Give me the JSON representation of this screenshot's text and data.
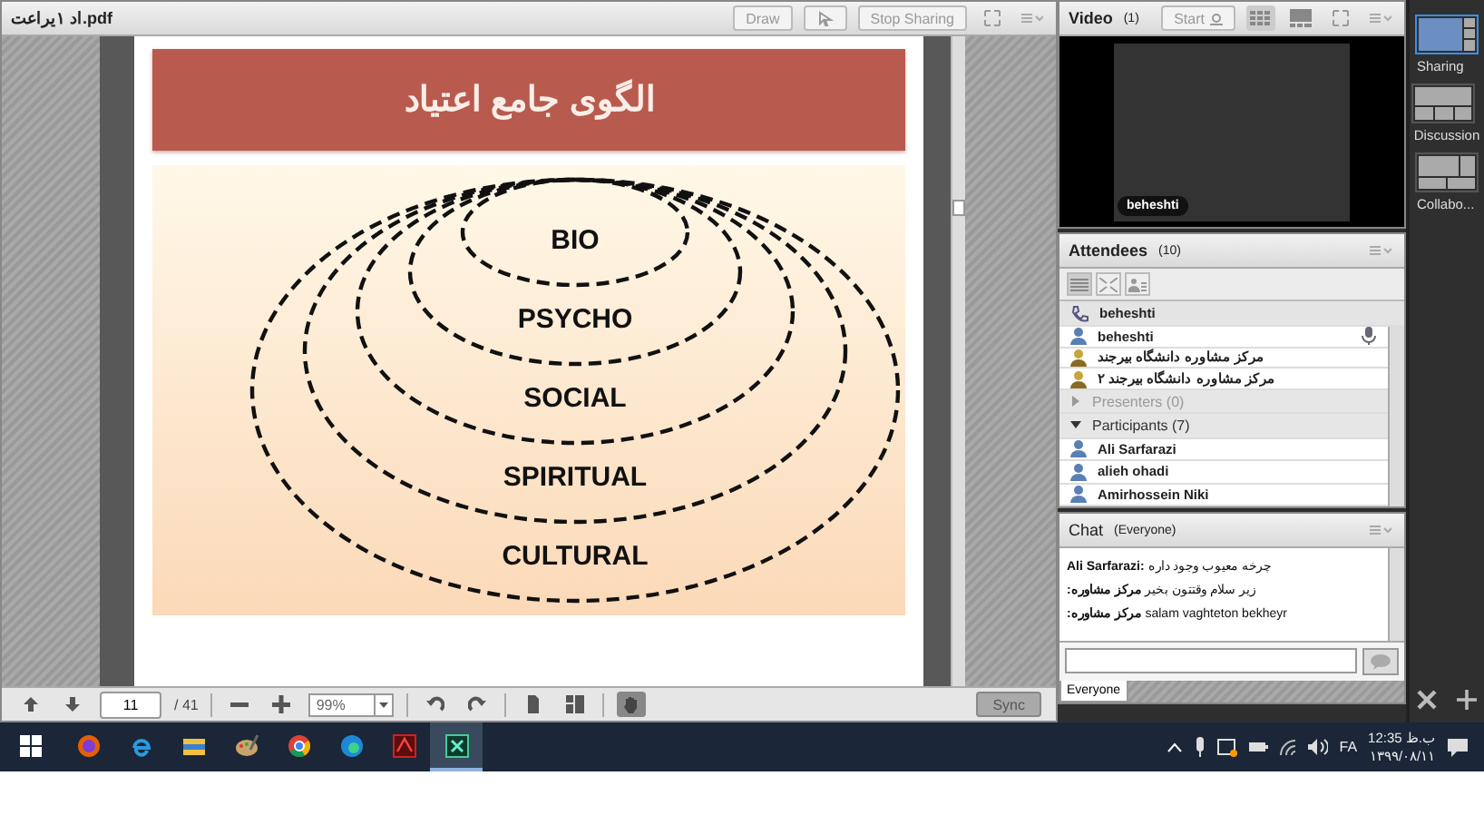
{
  "share_pod": {
    "title": "اد ۱یراعت.pdf",
    "buttons": [
      {
        "kind": "text",
        "label": "Draw"
      },
      {
        "kind": "pointer"
      },
      {
        "kind": "text",
        "label": "Stop Sharing"
      },
      {
        "kind": "fullscreen"
      },
      {
        "kind": "menu"
      }
    ]
  },
  "slide": {
    "title": "الگوی جامع اعتیاد",
    "rings": [
      "BIO",
      "PSYCHO",
      "SOCIAL",
      "SPIRITUAL",
      "CULTURAL"
    ]
  },
  "pdf_toolbar": {
    "page": "11",
    "page_count": "/ 41",
    "zoom": "99%",
    "sync": "Sync"
  },
  "video_pod": {
    "title": "Video",
    "count": "(1)",
    "start": "Start",
    "name_tag": "beheshti"
  },
  "attendees_pod": {
    "title": "Attendees",
    "count": "(10)",
    "me": "beheshti",
    "hosts": [
      {
        "name": "beheshti",
        "mic": true
      },
      {
        "name": "مرکز مشاوره دانشگاه بیرجند",
        "mic": false
      },
      {
        "name": "مرکز مشاوره دانشگاه بیرجند ۲",
        "mic": false
      }
    ],
    "groups": [
      {
        "label": "Presenters (0)",
        "expanded": false,
        "disabled": true
      },
      {
        "label": "Participants (7)",
        "expanded": true,
        "disabled": false
      }
    ],
    "participants": [
      "Ali Sarfarazi",
      "alieh ohadi",
      "Amirhossein Niki"
    ]
  },
  "chat_pod": {
    "title": "Chat",
    "scope": "(Everyone)",
    "messages": [
      {
        "sender": "Ali Sarfarazi:",
        "text": "چرخه معیوب وجود داره"
      },
      {
        "sender": "مرکز مشاوره:",
        "text": "زیر سلام وقتتون بخیر"
      },
      {
        "sender": "مرکز مشاوره:",
        "text": "salam vaghteton bekheyr"
      }
    ],
    "tab": "Everyone"
  },
  "layouts": [
    {
      "label": "Sharing",
      "selected": true,
      "kind": "sharing"
    },
    {
      "label": "Discussion",
      "selected": false,
      "kind": "discussion"
    },
    {
      "label": "Collabo...",
      "selected": false,
      "kind": "collab"
    }
  ],
  "taskbar": {
    "apps": [
      {
        "kind": "firefox",
        "active": false
      },
      {
        "kind": "ie",
        "active": false
      },
      {
        "kind": "folder",
        "active": false
      },
      {
        "kind": "paint",
        "active": false
      },
      {
        "kind": "chrome",
        "active": false
      },
      {
        "kind": "edge",
        "active": false
      },
      {
        "kind": "acrobat",
        "active": false
      },
      {
        "kind": "connect",
        "active": true
      }
    ],
    "language": "FA",
    "time": "12:35 ب.ظ",
    "date": "۱۳۹۹/۰۸/۱۱"
  }
}
